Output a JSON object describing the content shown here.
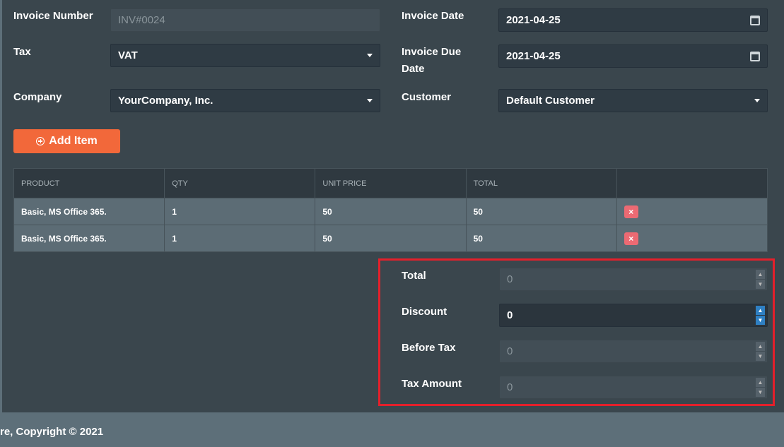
{
  "form": {
    "invoice_number_label": "Invoice Number",
    "invoice_number_value": "INV#0024",
    "invoice_date_label": "Invoice Date",
    "invoice_date_value": "2021-04-25",
    "tax_label": "Tax",
    "tax_value": "VAT",
    "due_date_label_line1": "Invoice Due",
    "due_date_label_line2": "Date",
    "due_date_value": "2021-04-25",
    "company_label": "Company",
    "company_value": "YourCompany, Inc.",
    "customer_label": "Customer",
    "customer_value": "Default Customer"
  },
  "add_item_label": "Add Item",
  "table": {
    "headers": [
      "PRODUCT",
      "QTY",
      "UNIT PRICE",
      "TOTAL",
      ""
    ],
    "rows": [
      {
        "product": "Basic, MS Office 365.",
        "qty": "1",
        "unit_price": "50",
        "total": "50"
      },
      {
        "product": "Basic, MS Office 365.",
        "qty": "1",
        "unit_price": "50",
        "total": "50"
      }
    ],
    "delete_glyph": "×"
  },
  "totals": {
    "total_label": "Total",
    "total_value": "0",
    "discount_label": "Discount",
    "discount_value": "0",
    "before_tax_label": "Before Tax",
    "before_tax_value": "0",
    "tax_amount_label": "Tax Amount",
    "tax_amount_value": "0"
  },
  "footer": {
    "copyright": "re, Copyright © 2021"
  },
  "colors": {
    "accent": "#f2683a",
    "highlight": "#e4202b",
    "panel": "#3a464d",
    "danger": "#ec6a73"
  }
}
